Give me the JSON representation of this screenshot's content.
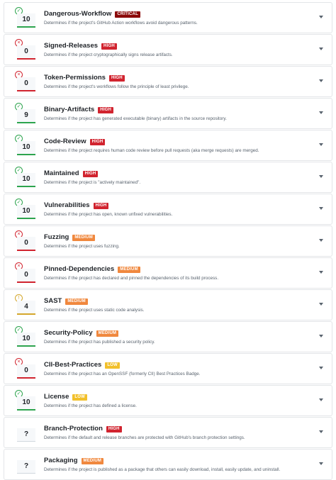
{
  "checks": [
    {
      "name": "Dangerous-Workflow",
      "risk": "CRITICAL",
      "risk_level": "critical",
      "score": "10",
      "status": "pass",
      "description": "Determines if the project's GitHub Action workflows avoid dangerous patterns.",
      "status_icon": "check-circle-icon"
    },
    {
      "name": "Signed-Releases",
      "risk": "HIGH",
      "risk_level": "high",
      "score": "0",
      "status": "fail",
      "description": "Determines if the project cryptographically signs release artifacts.",
      "status_icon": "x-circle-icon"
    },
    {
      "name": "Token-Permissions",
      "risk": "HIGH",
      "risk_level": "high",
      "score": "0",
      "status": "fail",
      "description": "Determines if the project's workflows follow the principle of least privilege.",
      "status_icon": "x-circle-icon"
    },
    {
      "name": "Binary-Artifacts",
      "risk": "HIGH",
      "risk_level": "high",
      "score": "9",
      "status": "pass",
      "description": "Determines if the project has generated executable (binary) artifacts in the source repository.",
      "status_icon": "check-circle-icon"
    },
    {
      "name": "Code-Review",
      "risk": "HIGH",
      "risk_level": "high",
      "score": "10",
      "status": "pass",
      "description": "Determines if the project requires human code review before pull requests (aka merge requests) are merged.",
      "status_icon": "check-circle-icon"
    },
    {
      "name": "Maintained",
      "risk": "HIGH",
      "risk_level": "high",
      "score": "10",
      "status": "pass",
      "description": "Determines if the project is \"actively maintained\".",
      "status_icon": "check-circle-icon"
    },
    {
      "name": "Vulnerabilities",
      "risk": "HIGH",
      "risk_level": "high",
      "score": "10",
      "status": "pass",
      "description": "Determines if the project has open, known unfixed vulnerabilities.",
      "status_icon": "check-circle-icon"
    },
    {
      "name": "Fuzzing",
      "risk": "MEDIUM",
      "risk_level": "medium",
      "score": "0",
      "status": "fail",
      "description": "Determines if the project uses fuzzing.",
      "status_icon": "x-circle-icon"
    },
    {
      "name": "Pinned-Dependencies",
      "risk": "MEDIUM",
      "risk_level": "medium",
      "score": "0",
      "status": "fail",
      "description": "Determines if the project has declared and pinned the dependencies of its build process.",
      "status_icon": "x-circle-icon"
    },
    {
      "name": "SAST",
      "risk": "MEDIUM",
      "risk_level": "medium",
      "score": "4",
      "status": "warn",
      "description": "Determines if the project uses static code analysis.",
      "status_icon": "warning-circle-icon"
    },
    {
      "name": "Security-Policy",
      "risk": "MEDIUM",
      "risk_level": "medium",
      "score": "10",
      "status": "pass",
      "description": "Determines if the project has published a security policy.",
      "status_icon": "check-circle-icon"
    },
    {
      "name": "CII-Best-Practices",
      "risk": "LOW",
      "risk_level": "low",
      "score": "0",
      "status": "fail",
      "description": "Determines if the project has an OpenSSF (formerly CII) Best Practices Badge.",
      "status_icon": "x-circle-icon"
    },
    {
      "name": "License",
      "risk": "LOW",
      "risk_level": "low",
      "score": "10",
      "status": "pass",
      "description": "Determines if the project has defined a license.",
      "status_icon": "check-circle-icon"
    },
    {
      "name": "Branch-Protection",
      "risk": "HIGH",
      "risk_level": "high",
      "score": "?",
      "status": "none",
      "description": "Determines if the default and release branches are protected with GitHub's branch protection settings.",
      "status_icon": ""
    },
    {
      "name": "Packaging",
      "risk": "MEDIUM",
      "risk_level": "medium",
      "score": "?",
      "status": "none",
      "description": "Determines if the project is published as a package that others can easily download, install, easily update, and uninstall.",
      "status_icon": ""
    }
  ],
  "colors": {
    "pass": "#2da44e",
    "fail": "#d1242f",
    "warn": "#d4a72c",
    "critical": "#8b0a0a",
    "high": "#d1242f",
    "medium": "#f0883e",
    "low": "#f2c02b"
  }
}
